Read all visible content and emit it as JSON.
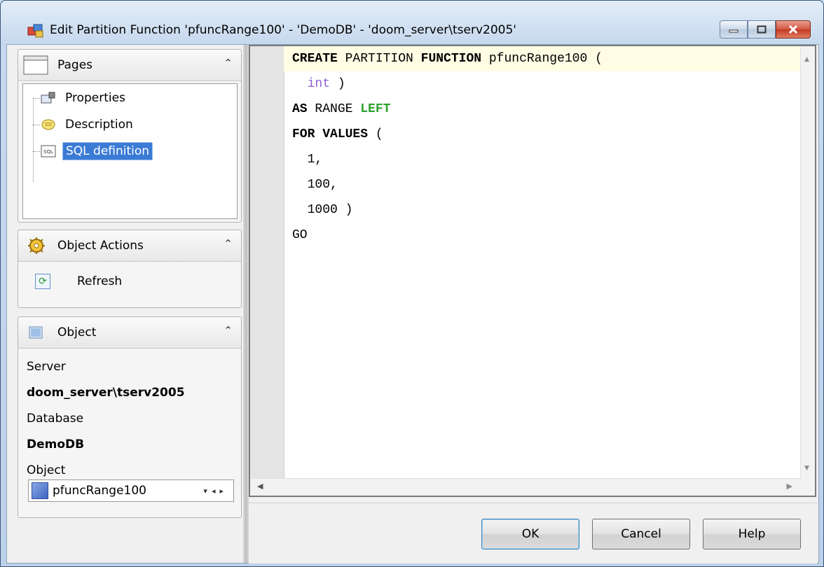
{
  "window": {
    "title": "Edit Partition Function 'pfuncRange100' - 'DemoDB' - 'doom_server\\tserv2005'"
  },
  "pages": {
    "header": "Pages",
    "items": [
      {
        "label": "Properties",
        "icon": "properties-icon"
      },
      {
        "label": "Description",
        "icon": "description-icon"
      },
      {
        "label": "SQL definition",
        "icon": "sql-icon",
        "selected": true
      }
    ]
  },
  "actions": {
    "header": "Object Actions",
    "refresh_label": "Refresh"
  },
  "object": {
    "header": "Object",
    "server_label": "Server",
    "server_value": "doom_server\\tserv2005",
    "database_label": "Database",
    "database_value": "DemoDB",
    "object_label": "Object",
    "object_selected": "pfuncRange100"
  },
  "sql": {
    "lines": [
      "CREATE PARTITION FUNCTION pfuncRange100 (",
      "  int )",
      "AS RANGE LEFT",
      "FOR VALUES (",
      "  1,",
      "  100,",
      "  1000 )",
      "GO"
    ]
  },
  "buttons": {
    "ok": "OK",
    "cancel": "Cancel",
    "help": "Help"
  },
  "colors": {
    "selection": "#3a7bd5",
    "keyword_type": "#8e5fd6",
    "keyword_green": "#2ea12e"
  }
}
